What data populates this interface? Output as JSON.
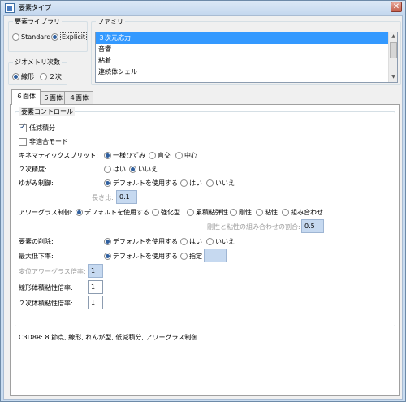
{
  "window": {
    "title": "要素タイプ",
    "close_glyph": "✕"
  },
  "element_library": {
    "legend": "要素ライブラリ",
    "options": [
      "Standard",
      "Explicit"
    ],
    "selected": "Explicit"
  },
  "geometric_order": {
    "legend": "ジオメトリ次数",
    "options": [
      "線形",
      "２次"
    ],
    "selected": "線形"
  },
  "family": {
    "legend": "ファミリ",
    "items": [
      "３次元応力",
      "音響",
      "粘着",
      "連続体シェル"
    ],
    "selected": "３次元応力"
  },
  "tabs": [
    "６面体",
    "５面体",
    "４面体"
  ],
  "active_tab": "６面体",
  "controls": {
    "legend": "要素コントロール",
    "reduced_integration": {
      "label": "低減積分",
      "checked": true
    },
    "incompatible_modes": {
      "label": "非適合モード",
      "checked": false
    },
    "kinematic_split": {
      "label": "キネマティックスプリット:",
      "options": [
        "一様ひずみ",
        "直交",
        "中心"
      ],
      "selected": "一様ひずみ"
    },
    "second_order_accuracy": {
      "label": "２次精度:",
      "options": [
        "はい",
        "いいえ"
      ],
      "selected": "いいえ"
    },
    "distortion_control": {
      "label": "ゆがみ制御:",
      "options": [
        "デフォルトを使用する",
        "はい",
        "いいえ"
      ],
      "selected": "デフォルトを使用する"
    },
    "length_ratio": {
      "label": "長さ比:",
      "value": "0.1"
    },
    "hourglass_control": {
      "label": "アワーグラス制御:",
      "options": [
        "デフォルトを使用する",
        "強化型",
        "累積粘弾性",
        "剛性",
        "粘性",
        "組み合わせ"
      ],
      "selected": "デフォルトを使用する"
    },
    "stiffness_viscosity_ratio": {
      "label": "剛性と粘性の組み合わせの割合:",
      "value": "0.5"
    },
    "element_deletion": {
      "label": "要素の削除:",
      "options": [
        "デフォルトを使用する",
        "はい",
        "いいえ"
      ],
      "selected": "デフォルトを使用する"
    },
    "max_degradation": {
      "label": "最大低下率:",
      "options": [
        "デフォルトを使用する",
        "指定"
      ],
      "selected": "デフォルトを使用する"
    },
    "displacement_hourglass_scale": {
      "label": "変位アワーグラス倍率:",
      "value": "1"
    },
    "linear_bulk_viscosity_scale": {
      "label": "線形体積粘性倍率:",
      "value": "1"
    },
    "quadratic_bulk_viscosity_scale": {
      "label": "２次体積粘性倍率:",
      "value": "1"
    }
  },
  "description": "C3D8R:  8 節点, 線形, れんが型, 低減積分, アワーグラス制御"
}
